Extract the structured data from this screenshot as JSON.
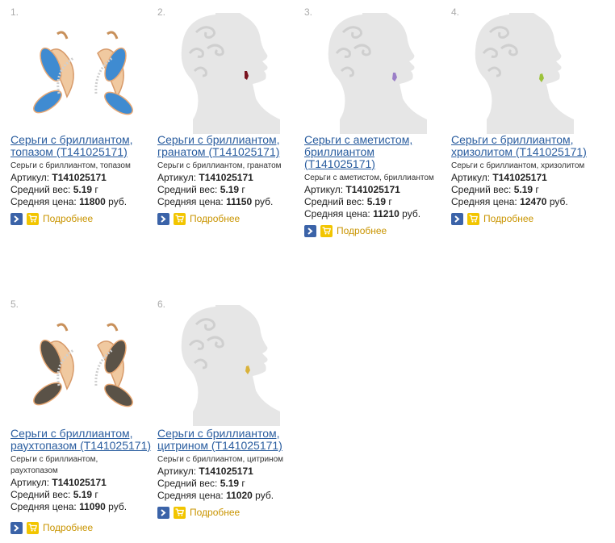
{
  "products": [
    {
      "num": "1.",
      "title_1": "Серьги с бриллиантом,",
      "title_2": "топазом (T141025171)",
      "subtitle_1": "Серьги с бриллиантом, топазом",
      "sku_label": "Артикул:",
      "sku": "T141025171",
      "weight_label": "Средний вес:",
      "weight": "5.19",
      "weight_unit": "г",
      "price_label": "Средняя цена:",
      "price": "11800",
      "price_unit": "руб.",
      "more_label": "Подробнее",
      "image": "earrings-photo",
      "stone_color": "#3f8bd1"
    },
    {
      "num": "2.",
      "title_1": "Серьги с бриллиантом,",
      "title_2": "гранатом (T141025171)",
      "subtitle_1": "Серьги с бриллиантом, гранатом",
      "sku_label": "Артикул:",
      "sku": "T141025171",
      "weight_label": "Средний вес:",
      "weight": "5.19",
      "weight_unit": "г",
      "price_label": "Средняя цена:",
      "price": "11150",
      "price_unit": "руб.",
      "more_label": "Подробнее",
      "image": "model-silhouette",
      "stone_color": "#7a1420"
    },
    {
      "num": "3.",
      "title_1": "Серьги с аметистом,",
      "title_2": "бриллиантом",
      "title_3": "(T141025171)",
      "subtitle_1": "Серьги с аметистом, бриллиантом",
      "sku_label": "Артикул:",
      "sku": "T141025171",
      "weight_label": "Средний вес:",
      "weight": "5.19",
      "weight_unit": "г",
      "price_label": "Средняя цена:",
      "price": "11210",
      "price_unit": "руб.",
      "more_label": "Подробнее",
      "image": "model-silhouette",
      "stone_color": "#9b7fc7"
    },
    {
      "num": "4.",
      "title_1": "Серьги с бриллиантом,",
      "title_2": "хризолитом (T141025171)",
      "subtitle_1": "Серьги с бриллиантом, хризолитом",
      "sku_label": "Артикул:",
      "sku": "T141025171",
      "weight_label": "Средний вес:",
      "weight": "5.19",
      "weight_unit": "г",
      "price_label": "Средняя цена:",
      "price": "12470",
      "price_unit": "руб.",
      "more_label": "Подробнее",
      "image": "model-silhouette",
      "stone_color": "#9cc23a"
    },
    {
      "num": "5.",
      "title_1": "Серьги с бриллиантом,",
      "title_2": "раухтопазом (T141025171)",
      "subtitle_1": "Серьги с бриллиантом,",
      "subtitle_2": "раухтопазом",
      "sku_label": "Артикул:",
      "sku": "T141025171",
      "weight_label": "Средний вес:",
      "weight": "5.19",
      "weight_unit": "г",
      "price_label": "Средняя цена:",
      "price": "11090",
      "price_unit": "руб.",
      "more_label": "Подробнее",
      "image": "earrings-photo",
      "stone_color": "#5a5247"
    },
    {
      "num": "6.",
      "title_1": "Серьги с бриллиантом,",
      "title_2": "цитрином (T141025171)",
      "subtitle_1": "Серьги с бриллиантом, цитрином",
      "sku_label": "Артикул:",
      "sku": "T141025171",
      "weight_label": "Средний вес:",
      "weight": "5.19",
      "weight_unit": "г",
      "price_label": "Средняя цена:",
      "price": "11020",
      "price_unit": "руб.",
      "more_label": "Подробнее",
      "image": "model-silhouette",
      "stone_color": "#d9b23a"
    }
  ],
  "colors": {
    "link": "#2a5d9f",
    "more": "#c99400",
    "go_button": "#3b63a8",
    "cart_button": "#f2c500",
    "silhouette": "#e6e6e6"
  }
}
